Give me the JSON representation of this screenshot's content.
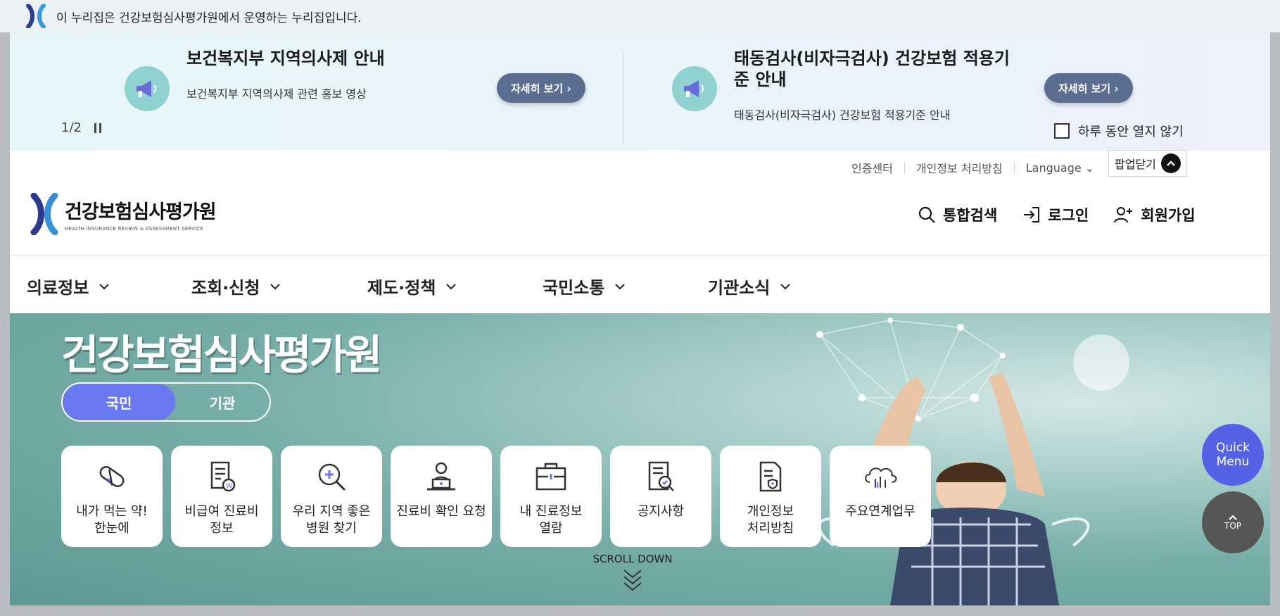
{
  "gov_notice": "이 누리집은 건강보험심사평가원에서 운영하는 누리집입니다.",
  "popup": {
    "items": [
      {
        "title": "보건복지부 지역의사제 안내",
        "desc": "보건복지부 지역의사제 관련 홍보 영상",
        "more": "자세히 보기 ›"
      },
      {
        "title": "태동검사(비자극검사) 건강보험 적용기준 안내",
        "desc": "태동검사(비자극검사) 건강보험 적용기준 안내",
        "more": "자세히 보기 ›"
      }
    ],
    "pager": "1/2",
    "no_show_today": "하루 동안 열지 않기"
  },
  "util": {
    "cert": "인증센터",
    "privacy": "개인정보 처리방침",
    "language": "Language ⌄",
    "close_popup": "팝업닫기"
  },
  "brand": {
    "name": "건강보험심사평가원",
    "sub": "HEALTH INSURANCE REVIEW & ASSESSMENT SERVICE"
  },
  "header": {
    "search": "통합검색",
    "login": "로그인",
    "join": "회원가입"
  },
  "gnb": [
    "의료정보",
    "조회·신청",
    "제도·정책",
    "국민소통",
    "기관소식"
  ],
  "hero": {
    "title": "건강보험심사평가원",
    "toggle": [
      "국민",
      "기관"
    ],
    "tiles": [
      {
        "label": "내가 먹는 약!\n한눈에",
        "icon": "pill-icon"
      },
      {
        "label": "비급여 진료비\n정보",
        "icon": "document-won-icon"
      },
      {
        "label": "우리 지역 좋은\n병원 찾기",
        "icon": "magnifier-plus-icon"
      },
      {
        "label": "진료비 확인 요청",
        "icon": "laptop-person-icon"
      },
      {
        "label": "내 진료정보\n열람",
        "icon": "briefcase-icon"
      },
      {
        "label": "공지사항",
        "icon": "notice-doc-icon"
      },
      {
        "label": "개인정보\n처리방침",
        "icon": "privacy-doc-icon"
      },
      {
        "label": "주요연계업무",
        "icon": "cloud-link-icon"
      }
    ],
    "scroll": "SCROLL DOWN"
  },
  "side": {
    "quick": "Quick\nMenu",
    "top": "TOP"
  },
  "colors": {
    "accent": "#6a79f0",
    "button": "#5b6e92",
    "quick": "#5463e6"
  }
}
